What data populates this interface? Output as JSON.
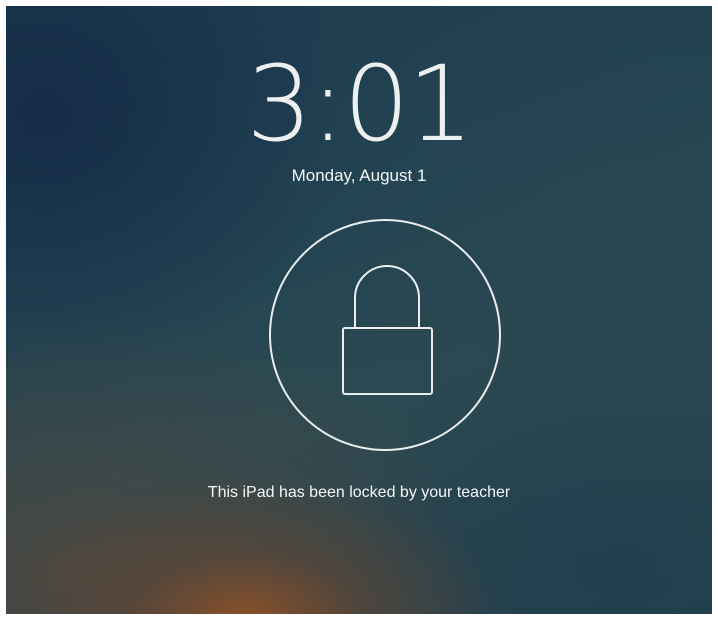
{
  "lock_screen": {
    "time": "3:01",
    "date": "Monday, August 1",
    "lock_icon": "padlock-icon",
    "message": "This iPad has been locked by your teacher"
  },
  "colors": {
    "text": "#ffffff",
    "background_top": "#1d3a4f",
    "background_bottom_glow": "#965224"
  }
}
